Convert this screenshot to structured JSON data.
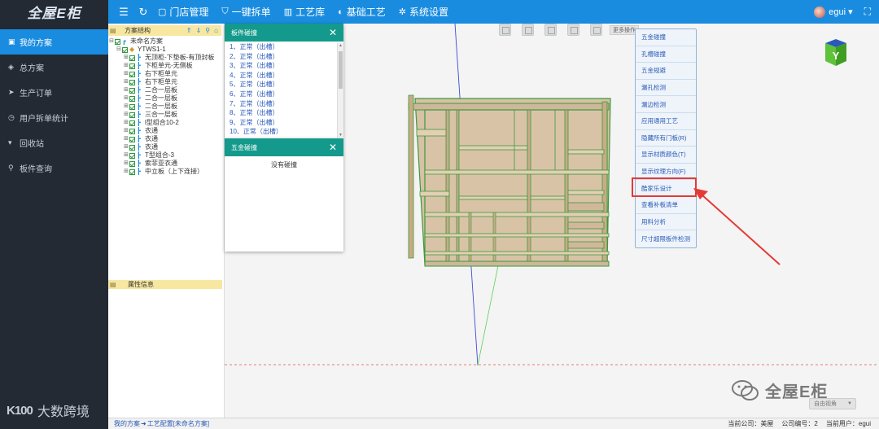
{
  "brand": {
    "logo": "全屋E柜"
  },
  "topnav": {
    "items": [
      {
        "label": "门店管理",
        "icon": "store-icon"
      },
      {
        "label": "一键拆单",
        "icon": "shield-icon"
      },
      {
        "label": "工艺库",
        "icon": "book-icon"
      },
      {
        "label": "基础工艺",
        "icon": "palette-icon"
      },
      {
        "label": "系统设置",
        "icon": "gear-icon"
      }
    ],
    "user": "egui"
  },
  "sidebar": {
    "items": [
      {
        "label": "我的方案",
        "active": true
      },
      {
        "label": "总方案"
      },
      {
        "label": "生产订单"
      },
      {
        "label": "用户拆单统计"
      },
      {
        "label": "回收站"
      },
      {
        "label": "板件查询"
      }
    ],
    "watermark": "大数跨境",
    "watermark_logo": "K100"
  },
  "tree": {
    "header": "方案结构",
    "root": "未命名方案",
    "project": "YTWS1-1",
    "children": [
      "无顶柜-下垫板-有顶封板",
      "下柜单元-无侧板",
      "右下柜单元",
      "右下柜单元",
      "二合一层板",
      "二合一层板",
      "二合一层板",
      "三合一层板",
      "l型组合10-2",
      "衣通",
      "衣通",
      "衣通",
      "T型组合-3",
      "索菲亚衣通",
      "中立板（上下连接）"
    ],
    "attr_header": "属性信息"
  },
  "collision_panel": {
    "title": "板件碰撞",
    "items": [
      "1、正常（出槽）",
      "2、正常（出槽）",
      "3、正常（出槽）",
      "4、正常（出槽）",
      "5、正常（出槽）",
      "6、正常（出槽）",
      "7、正常（出槽）",
      "8、正常（出槽）",
      "9、正常（出槽）",
      "10、正常（出槽）"
    ]
  },
  "hardware_panel": {
    "title": "五金碰撞",
    "empty_text": "没有碰撞"
  },
  "viewport": {
    "more_button": "更多操作",
    "menu": [
      "五金碰撞",
      "孔槽碰撞",
      "五金规避",
      "漏孔检测",
      "漏边检测",
      "应用通用工艺",
      "隐藏所有门板(R)",
      "显示材质颜色(T)",
      "显示纹理方向(F)",
      "酷家乐设计",
      "查看补板清单",
      "用料分析",
      "尺寸超限板件检测"
    ],
    "view_select": "自由视角",
    "watermark": "全屋E柜",
    "logo_letter": "Y"
  },
  "statusbar": {
    "crumbs": [
      "我的方案",
      "工艺配置[未命名方案]"
    ],
    "separator": "➜",
    "company_label": "当前公司：美屋",
    "company_no_label": "公司编号：2",
    "user_label": "当前用户：egui"
  }
}
